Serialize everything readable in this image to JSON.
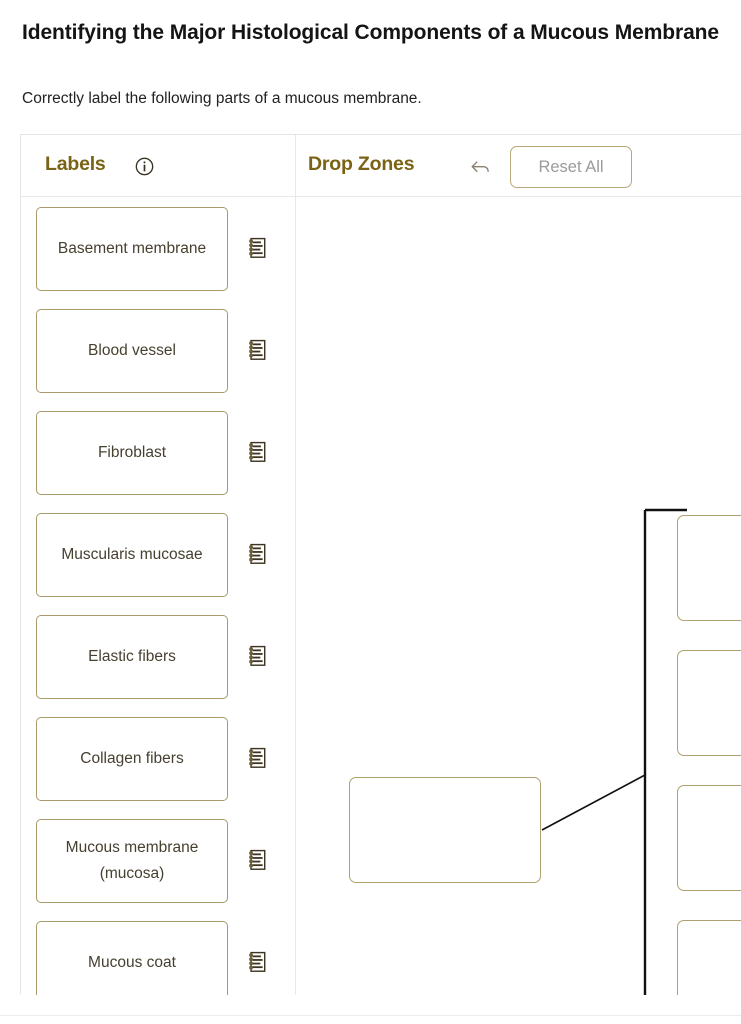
{
  "header": {
    "title": "Identifying the Major Histological Components of a Mucous Membrane",
    "instruction": "Correctly label the following parts of a mucous membrane."
  },
  "panel": {
    "labels_heading": "Labels",
    "labels_info_icon": "info-circle-icon",
    "dropzones_heading": "Drop Zones",
    "undo_icon": "undo-arrow-icon",
    "reset_button": "Reset All"
  },
  "labels": [
    {
      "text": "Basement membrane",
      "icon": "notepad-icon"
    },
    {
      "text": "Blood vessel",
      "icon": "notepad-icon"
    },
    {
      "text": "Fibroblast",
      "icon": "notepad-icon"
    },
    {
      "text": "Muscularis mucosae",
      "icon": "notepad-icon"
    },
    {
      "text": "Elastic fibers",
      "icon": "notepad-icon"
    },
    {
      "text": "Collagen fibers",
      "icon": "notepad-icon"
    },
    {
      "text": "Mucous membrane (mucosa)",
      "icon": "notepad-icon"
    },
    {
      "text": "Mucous coat",
      "icon": "notepad-icon"
    }
  ],
  "dropzones": [
    {
      "id": "dropzone-group-summary",
      "value": ""
    },
    {
      "id": "dropzone-1",
      "value": ""
    },
    {
      "id": "dropzone-2",
      "value": ""
    },
    {
      "id": "dropzone-3",
      "value": ""
    },
    {
      "id": "dropzone-4",
      "value": ""
    }
  ],
  "colors": {
    "heading_gold": "#7b6316",
    "card_border": "#a89a6a",
    "dropzone_border": "#b0a170",
    "card_text": "#46402f",
    "reset_text": "#9b9b9b",
    "bracket_line": "#111111"
  }
}
